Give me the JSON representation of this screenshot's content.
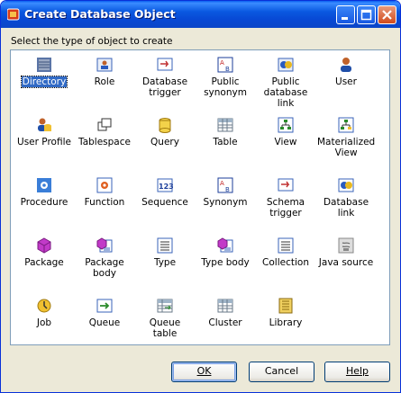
{
  "window": {
    "title": "Create Database Object"
  },
  "prompt": "Select the type of object to create",
  "items": [
    {
      "label": "Directory",
      "icon": "directory-icon"
    },
    {
      "label": "Role",
      "icon": "role-icon"
    },
    {
      "label": "Database trigger",
      "icon": "database-trigger-icon"
    },
    {
      "label": "Public synonym",
      "icon": "public-synonym-icon"
    },
    {
      "label": "Public database link",
      "icon": "public-database-link-icon"
    },
    {
      "label": "User",
      "icon": "user-icon"
    },
    {
      "label": "User Profile",
      "icon": "user-profile-icon"
    },
    {
      "label": "Tablespace",
      "icon": "tablespace-icon"
    },
    {
      "label": "Query",
      "icon": "query-icon"
    },
    {
      "label": "Table",
      "icon": "table-icon"
    },
    {
      "label": "View",
      "icon": "view-icon"
    },
    {
      "label": "Materialized View",
      "icon": "materialized-view-icon"
    },
    {
      "label": "Procedure",
      "icon": "procedure-icon"
    },
    {
      "label": "Function",
      "icon": "function-icon"
    },
    {
      "label": "Sequence",
      "icon": "sequence-icon"
    },
    {
      "label": "Synonym",
      "icon": "synonym-icon"
    },
    {
      "label": "Schema trigger",
      "icon": "schema-trigger-icon"
    },
    {
      "label": "Database link",
      "icon": "database-link-icon"
    },
    {
      "label": "Package",
      "icon": "package-icon"
    },
    {
      "label": "Package body",
      "icon": "package-body-icon"
    },
    {
      "label": "Type",
      "icon": "type-icon"
    },
    {
      "label": "Type body",
      "icon": "type-body-icon"
    },
    {
      "label": "Collection",
      "icon": "collection-icon"
    },
    {
      "label": "Java source",
      "icon": "java-source-icon"
    },
    {
      "label": "Job",
      "icon": "job-icon"
    },
    {
      "label": "Queue",
      "icon": "queue-icon"
    },
    {
      "label": "Queue table",
      "icon": "queue-table-icon"
    },
    {
      "label": "Cluster",
      "icon": "cluster-icon"
    },
    {
      "label": "Library",
      "icon": "library-icon"
    }
  ],
  "selected": "Directory",
  "buttons": {
    "ok": "OK",
    "cancel": "Cancel",
    "help": "Help"
  }
}
